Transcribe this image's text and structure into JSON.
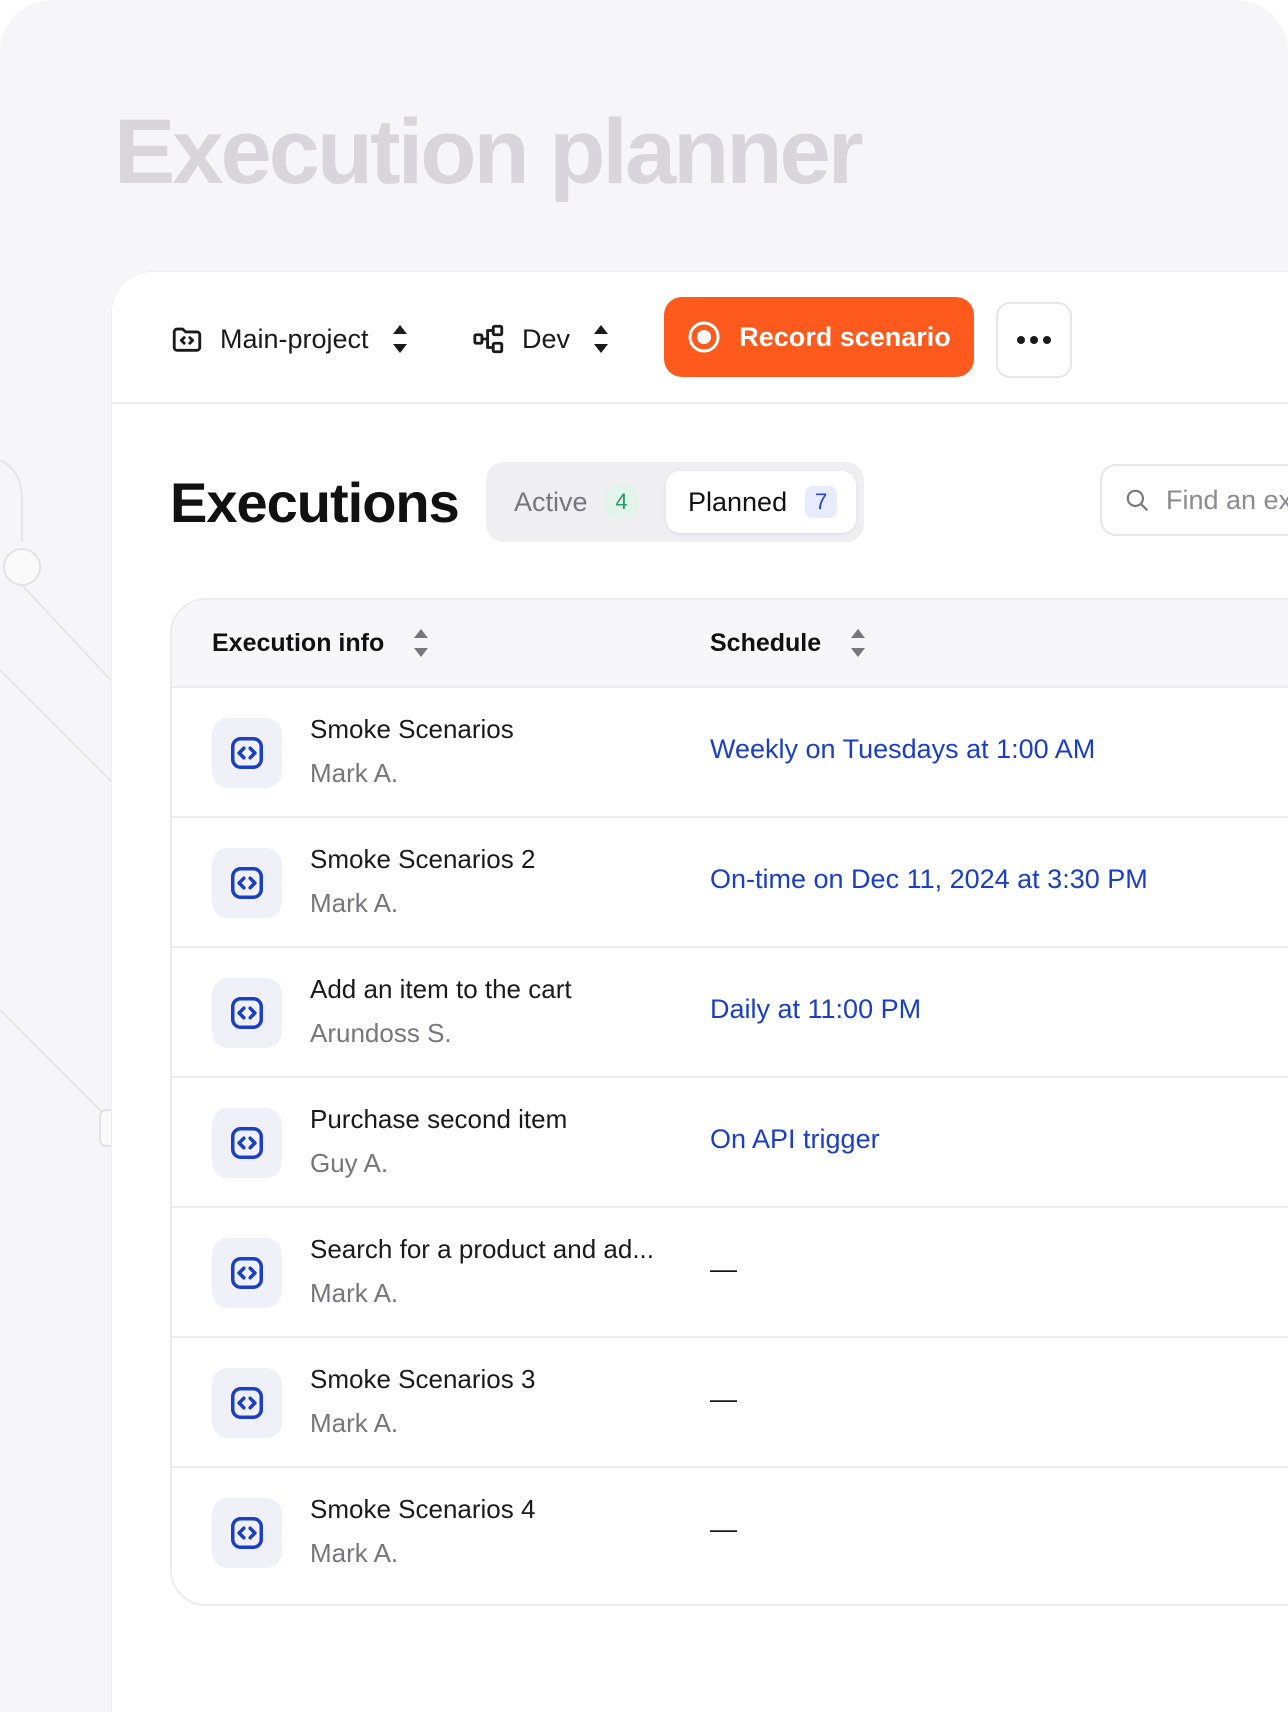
{
  "page": {
    "title": "Execution planner"
  },
  "toolbar": {
    "project": "Main-project",
    "environment": "Dev",
    "record_label": "Record scenario"
  },
  "executions": {
    "title": "Executions",
    "tabs": [
      {
        "label": "Active",
        "count": "4"
      },
      {
        "label": "Planned",
        "count": "7"
      }
    ],
    "search_placeholder": "Find an execution"
  },
  "table": {
    "columns": [
      "Execution info",
      "Schedule"
    ],
    "rows": [
      {
        "name": "Smoke Scenarios",
        "owner": "Mark A.",
        "schedule": "Weekly on Tuesdays at 1:00 AM"
      },
      {
        "name": "Smoke Scenarios 2",
        "owner": "Mark A.",
        "schedule": "On-time on Dec 11, 2024 at 3:30 PM"
      },
      {
        "name": "Add an item to the cart",
        "owner": "Arundoss S.",
        "schedule": "Daily at 11:00 PM"
      },
      {
        "name": "Purchase second item",
        "owner": "Guy A.",
        "schedule": "On API trigger"
      },
      {
        "name": "Search for a product and ad...",
        "owner": "Mark A.",
        "schedule": "—"
      },
      {
        "name": "Smoke Scenarios 3",
        "owner": "Mark A.",
        "schedule": "—"
      },
      {
        "name": "Smoke Scenarios 4",
        "owner": "Mark A.",
        "schedule": "—"
      }
    ]
  },
  "colors": {
    "accent": "#fe5a1d",
    "link": "#1a3fc4",
    "title_faded": "#d8d6da"
  },
  "icons": {
    "project": "folder-code-icon",
    "environment": "branch-icon",
    "record": "record-icon",
    "more": "more-dots-icon",
    "search": "search-icon",
    "sort": "sort-updown-icon",
    "scenario": "code-icon"
  }
}
